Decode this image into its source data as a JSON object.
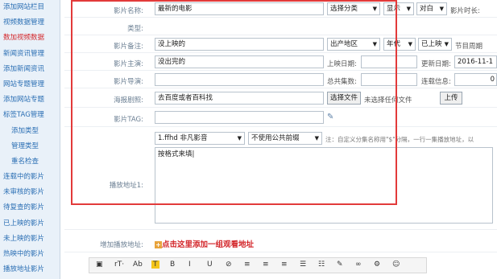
{
  "sidebar": {
    "items": [
      {
        "label": "添加网站栏目",
        "active": false,
        "sub": false
      },
      {
        "label": "视频数据管理",
        "active": false,
        "sub": false
      },
      {
        "label": "数加视频数据",
        "active": true,
        "sub": false
      },
      {
        "label": "新闻资讯管理",
        "active": false,
        "sub": false
      },
      {
        "label": "添加新闻资讯",
        "active": false,
        "sub": false
      },
      {
        "label": "网站专题管理",
        "active": false,
        "sub": false
      },
      {
        "label": "添加网站专题",
        "active": false,
        "sub": false
      },
      {
        "label": "标签TAG管理",
        "active": false,
        "sub": false
      },
      {
        "label": "添加类型",
        "active": false,
        "sub": true
      },
      {
        "label": "管理类型",
        "active": false,
        "sub": true
      },
      {
        "label": "重名检查",
        "active": false,
        "sub": true
      },
      {
        "label": "连载中的影片",
        "active": false,
        "sub": false
      },
      {
        "label": "未审核的影片",
        "active": false,
        "sub": false
      },
      {
        "label": "待复查的影片",
        "active": false,
        "sub": false
      },
      {
        "label": "已上映的影片",
        "active": false,
        "sub": false
      },
      {
        "label": "未上映的影片",
        "active": false,
        "sub": false
      },
      {
        "label": "热映中的影片",
        "active": false,
        "sub": false
      },
      {
        "label": "播放地址影片",
        "active": false,
        "sub": false
      }
    ]
  },
  "form": {
    "title_label": "影片名称:",
    "title_value": "最新的电影",
    "category_select": "选择分类",
    "display_select": "显示",
    "color_select": "对白",
    "duration_label": "影片时长:",
    "type_label": "类型:",
    "remark_label": "影片备注:",
    "remark_value": "没上映的",
    "region_select": "出产地区",
    "year_select": "年代",
    "status_select": "已上映",
    "schedule_label": "节目周期",
    "actor_label": "影片主演:",
    "actor_value": "没出完的",
    "release_label": "上映日期:",
    "update_label": "更新日期:",
    "update_value": "2016-11-1",
    "director_label": "影片导演:",
    "episodes_label": "总共集数:",
    "serial_label": "连载信息:",
    "serial_value": "0",
    "poster_label": "海报剧照:",
    "poster_value": "去百度或者百科找",
    "choose_file_button": "选择文件",
    "no_file_text": "未选择任何文件",
    "upload_button": "上传",
    "tag_label": "影片TAG:",
    "player_select": "1.ffhd 非凡影音",
    "server_select": "不使用公共前缀",
    "note_text": "注：自定义分集名称用\"$\"分隔，一行一集播放地址，以",
    "address_label": "播放地址1:",
    "address_value": "按格式来填|",
    "add_label": "增加播放地址:",
    "add_link": "点击这里添加一组观看地址"
  },
  "toolbar": {
    "items": [
      "▣",
      "rT·",
      "Ab",
      "T",
      "B",
      "I",
      "U",
      "⊘",
      "≡",
      "≡",
      "≡",
      "☰",
      "☷",
      "✎",
      "∞",
      "⚙",
      "☺"
    ]
  },
  "colors": {
    "sidebar_link": "#2b6fb4",
    "sidebar_active": "#d3262a",
    "highlight_border": "#e23a3a",
    "add_link": "#d3262a"
  }
}
